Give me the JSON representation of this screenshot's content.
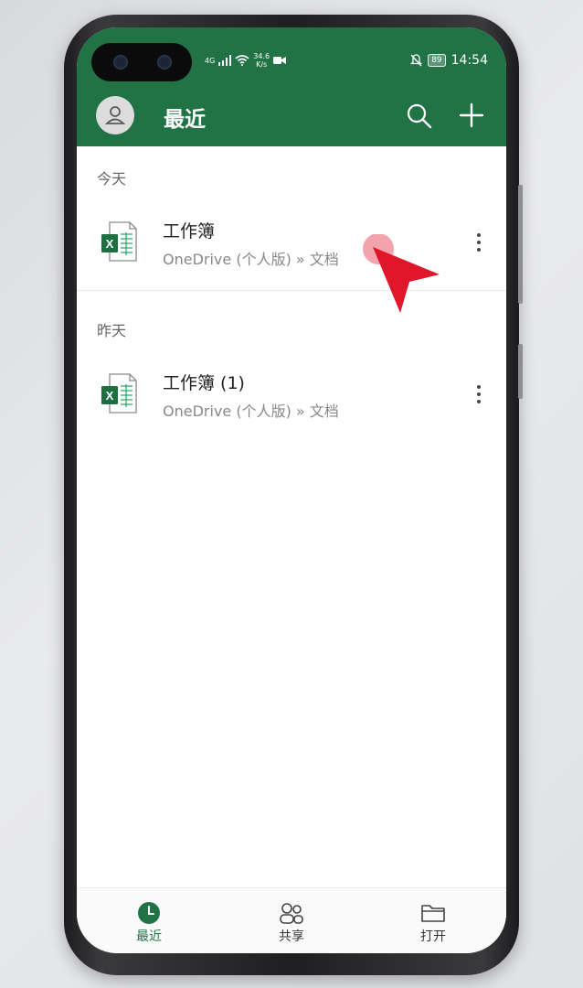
{
  "status_bar": {
    "network": "4G",
    "speed_value": "34.6",
    "speed_unit": "K/s",
    "battery": "89",
    "time": "14:54"
  },
  "app_bar": {
    "title": "最近"
  },
  "sections": [
    {
      "label": "今天",
      "files": [
        {
          "name": "工作簿",
          "path": "OneDrive (个人版) » 文档"
        }
      ]
    },
    {
      "label": "昨天",
      "files": [
        {
          "name": "工作簿 (1)",
          "path": "OneDrive (个人版) » 文档"
        }
      ]
    }
  ],
  "bottom_nav": [
    {
      "label": "最近",
      "icon": "clock-icon",
      "active": true
    },
    {
      "label": "共享",
      "icon": "people-icon",
      "active": false
    },
    {
      "label": "打开",
      "icon": "folder-icon",
      "active": false
    }
  ],
  "colors": {
    "brand": "#217346",
    "pointer": "#e0162b"
  }
}
